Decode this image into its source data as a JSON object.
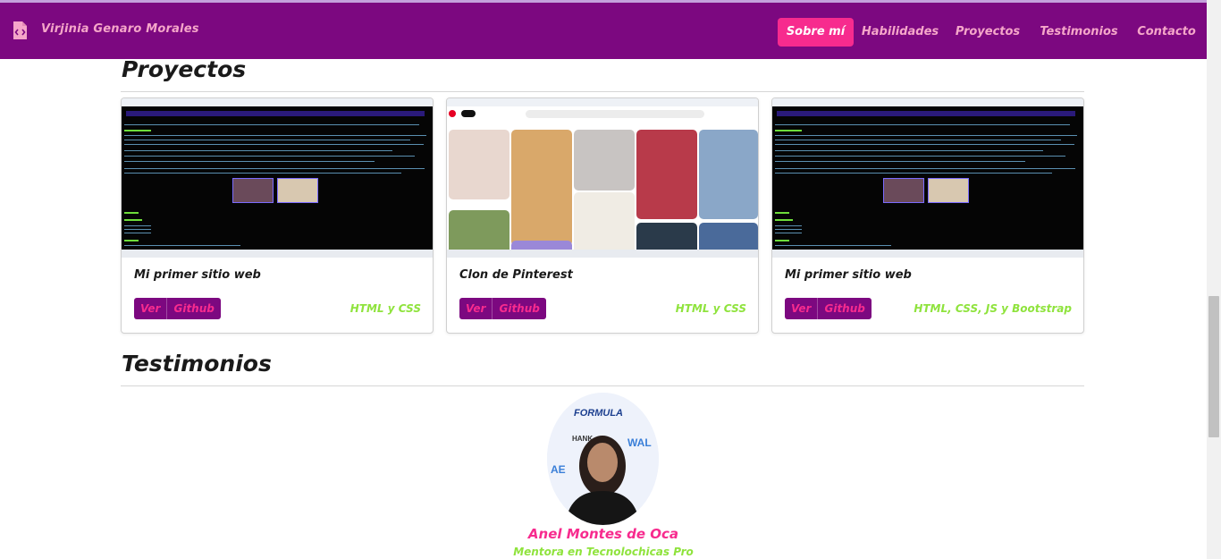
{
  "navbar": {
    "brand_name": "Virjinia Genaro Morales",
    "items": [
      {
        "label": "Sobre mí",
        "active": true
      },
      {
        "label": "Habilidades",
        "active": false
      },
      {
        "label": "Proyectos",
        "active": false
      },
      {
        "label": "Testimonios",
        "active": false
      },
      {
        "label": "Contacto",
        "active": false
      }
    ]
  },
  "projects": {
    "title": "Proyectos",
    "cards": [
      {
        "title": "Mi primer sitio web",
        "buttons": [
          "Ver",
          "Github"
        ],
        "tech": "HTML y CSS"
      },
      {
        "title": "Clon de Pinterest",
        "buttons": [
          "Ver",
          "Github"
        ],
        "tech": "HTML y CSS"
      },
      {
        "title": "Mi primer sitio web",
        "buttons": [
          "Ver",
          "Github"
        ],
        "tech": "HTML, CSS, JS y Bootstrap"
      }
    ]
  },
  "testimonials": {
    "title": "Testimonios",
    "name": "Anel Montes de Oca",
    "role": "Mentora en Tecnolochicas Pro"
  },
  "colors": {
    "navbar_bg": "#7c0880",
    "accent_pink": "#f72b8e",
    "nav_text": "#f5a6c9",
    "accent_green": "#8fe33d"
  },
  "icons": {
    "brand": "code-file-icon"
  }
}
